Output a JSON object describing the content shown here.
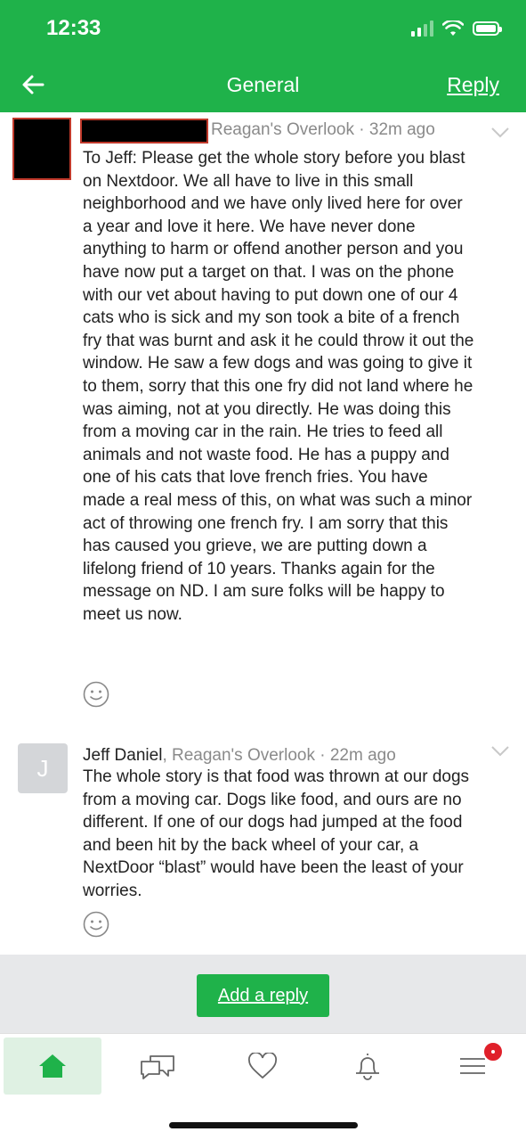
{
  "status_bar": {
    "time": "12:33"
  },
  "header": {
    "title": "General",
    "reply_label": "Reply",
    "back_icon": "arrow-left-icon"
  },
  "comments": [
    {
      "author": "",
      "neighborhood_meta": "Reagan's Overlook · 32m ago",
      "body": "To Jeff: Please get the whole story before you blast on Nextdoor. We all have to live in this small neighborhood and we have only lived here for over a year and love it here. We have never done anything to harm or offend another person and you have now put a target on that. I was on the phone with our vet about having to put down one of our 4 cats who is sick and my son took a bite of a french fry that was burnt and ask it he could throw it out the window. He saw a few dogs and was going to give it to them, sorry that this one fry did not land where he was aiming, not at you directly. He was doing this from a moving car in the rain. He tries to feed all animals and not waste food. He has a puppy and one of his cats that love french fries. You have made a real mess of this, on what was such a minor act of throwing one french fry. I am sorry that this has caused you grieve, we are putting down a lifelong friend of 10 years. Thanks again for the message on ND. I am sure folks will be happy to meet us now."
    },
    {
      "avatar_initial": "J",
      "author": "Jeff Daniel",
      "neighborhood_meta": ", Reagan's Overlook · 22m ago",
      "body": "The whole story is that food was thrown at our dogs from a moving car. Dogs like food, and ours are no different. If one of our dogs had jumped at the food and been hit by the back wheel of your car, a NextDoor “blast” would have been the least of your worries."
    }
  ],
  "reply_bar": {
    "add_reply_label": "Add a reply"
  },
  "tabs": [
    {
      "icon": "home-icon",
      "active": true
    },
    {
      "icon": "chat-icon",
      "active": false
    },
    {
      "icon": "heart-icon",
      "active": false
    },
    {
      "icon": "bell-icon",
      "active": false
    },
    {
      "icon": "menu-icon",
      "active": false,
      "badge": true
    }
  ],
  "colors": {
    "brand_green": "#1fb24a",
    "badge_red": "#e0202a"
  }
}
